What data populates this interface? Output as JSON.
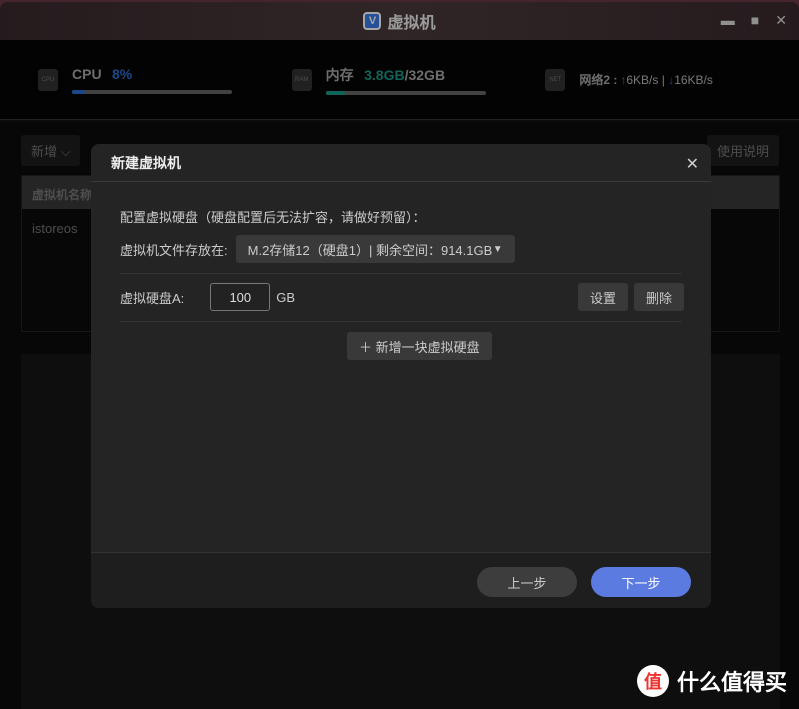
{
  "window": {
    "title": "虚拟机",
    "logo": "V"
  },
  "stats": {
    "cpu_label": "CPU",
    "cpu_value": "8%",
    "cpu_percent": 8,
    "mem_label": "内存",
    "mem_used": "3.8GB",
    "mem_sep": "/",
    "mem_total": "32GB",
    "mem_percent": 12,
    "net_label": "网络2 :",
    "net_up": "↑",
    "net_up_value": "6KB/s",
    "net_sep": "|",
    "net_down": "↓",
    "net_down_value": "16KB/s",
    "chip_cpu": "CPU",
    "chip_ram": "RAM",
    "chip_net": "NET"
  },
  "toolbar": {
    "add": "新增 ⌵",
    "help": "使用说明"
  },
  "table": {
    "header": "虚拟机名称",
    "rows": [
      "istoreos"
    ]
  },
  "dialog": {
    "title": "新建虚拟机",
    "close": "✕",
    "intro": "配置虚拟硬盘（硬盘配置后无法扩容，请做好预留）：",
    "location_label": "虚拟机文件存放在:",
    "location_value": "M.2存储12（硬盘1）| 剩余空间：914.1GB",
    "disk_label": "虚拟硬盘A:",
    "disk_size": "100",
    "disk_unit": "GB",
    "settings": "设置",
    "delete": "删除",
    "add_disk": "＋  新增一块虚拟硬盘",
    "prev": "上一步",
    "next": "下一步"
  },
  "watermark": {
    "text": "什么值得买",
    "icon": "值"
  },
  "colors": {
    "cpu": "#2b6fd6",
    "mem": "#1a9a8a",
    "primary": "#5b7be0"
  }
}
